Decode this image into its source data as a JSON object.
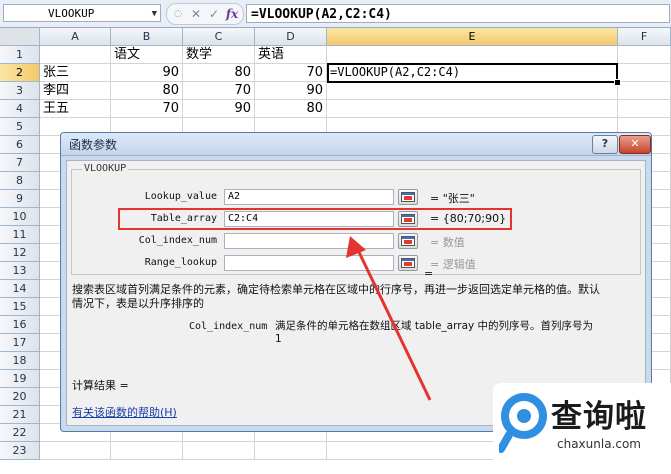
{
  "formula_bar": {
    "name_box": "VLOOKUP",
    "cancel_glyph": "✕",
    "enter_glyph": "✓",
    "fx_label": "fx",
    "formula": "=VLOOKUP(A2,C2:C4)"
  },
  "columns": [
    "A",
    "B",
    "C",
    "D",
    "E",
    "F"
  ],
  "rows": [
    "1",
    "2",
    "3",
    "4",
    "5",
    "6",
    "7",
    "8",
    "9",
    "10",
    "11",
    "12",
    "13",
    "14",
    "15",
    "16",
    "17",
    "18",
    "19",
    "20",
    "21",
    "22",
    "23"
  ],
  "selected": {
    "column": "E",
    "row": "2"
  },
  "sheet": {
    "header": {
      "b": "语文",
      "c": "数学",
      "d": "英语"
    },
    "records": [
      {
        "name": "张三",
        "b": "90",
        "c": "80",
        "d": "70"
      },
      {
        "name": "李四",
        "b": "80",
        "c": "70",
        "d": "90"
      },
      {
        "name": "王五",
        "b": "70",
        "c": "90",
        "d": "80"
      }
    ],
    "active_cell_value": "=VLOOKUP(A2,C2:C4)"
  },
  "dialog": {
    "title": "函数参数",
    "help_button": "?",
    "close_button": "✕",
    "function_name": "VLOOKUP",
    "args": [
      {
        "label": "Lookup_value",
        "value": "A2",
        "result": "= \"张三\"",
        "hint": false
      },
      {
        "label": "Table_array",
        "value": "C2:C4",
        "result": "= {80;70;90}",
        "hint": false
      },
      {
        "label": "Col_index_num",
        "value": "",
        "result": "= 数值",
        "hint": true
      },
      {
        "label": "Range_lookup",
        "value": "",
        "result": "= 逻辑值",
        "hint": true
      }
    ],
    "overall_eq": "=",
    "description_line1": "搜索表区域首列满足条件的元素，确定待检索单元格在区域中的行序号，再进一步返回选定单元格的值。默认",
    "description_line2": "情况下，表是以升序排序的",
    "param_name": "Col_index_num",
    "param_desc_line1": "满足条件的单元格在数组区域 table_array 中的列序号。首列序号为",
    "param_desc_line2": "1",
    "result_label": "计算结果 =",
    "help_link": "有关该函数的帮助(H)"
  },
  "watermark": {
    "text": "查询啦",
    "url": "chaxunla.com"
  },
  "colors": {
    "highlight": "#e3342f",
    "selection": "#f5c86a",
    "watermark_blue": "#2f8fe0"
  }
}
